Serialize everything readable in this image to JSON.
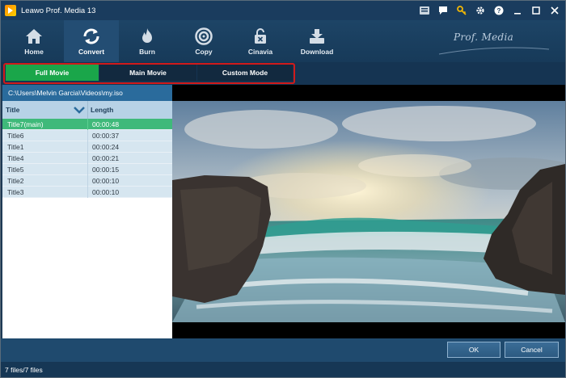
{
  "window": {
    "title": "Leawo Prof. Media 13",
    "titlebar_icons": [
      "register-icon",
      "chat-icon",
      "key-icon",
      "gear-icon",
      "help-icon",
      "minimize-icon",
      "maximize-icon",
      "close-icon"
    ]
  },
  "toolbar": {
    "items": [
      {
        "label": "Home",
        "icon": "home-icon"
      },
      {
        "label": "Convert",
        "icon": "convert-icon",
        "active": true
      },
      {
        "label": "Burn",
        "icon": "burn-icon"
      },
      {
        "label": "Copy",
        "icon": "copy-icon"
      },
      {
        "label": "Cinavia",
        "icon": "cinavia-icon"
      },
      {
        "label": "Download",
        "icon": "download-icon"
      }
    ],
    "brand": "Prof. Media"
  },
  "modes": {
    "full_movie": "Full Movie",
    "main_movie": "Main Movie",
    "custom_mode": "Custom Mode",
    "selected": "Full Movie",
    "highlight_color": "#d11a1a",
    "active_color": "#1aa64a"
  },
  "source": {
    "path": "C:\\Users\\Melvin Garcia\\Videos\\my.iso"
  },
  "titles_table": {
    "columns": [
      "Title",
      "Length"
    ],
    "rows": [
      {
        "title": "Title7(main)",
        "length": "00:00:48",
        "selected": true
      },
      {
        "title": "Title6",
        "length": "00:00:37"
      },
      {
        "title": "Title1",
        "length": "00:00:24"
      },
      {
        "title": "Title4",
        "length": "00:00:21"
      },
      {
        "title": "Title5",
        "length": "00:00:15"
      },
      {
        "title": "Title2",
        "length": "00:00:10"
      },
      {
        "title": "Title3",
        "length": "00:00:10"
      }
    ]
  },
  "footer": {
    "ok_label": "OK",
    "cancel_label": "Cancel",
    "status": "7 files/7 files"
  }
}
